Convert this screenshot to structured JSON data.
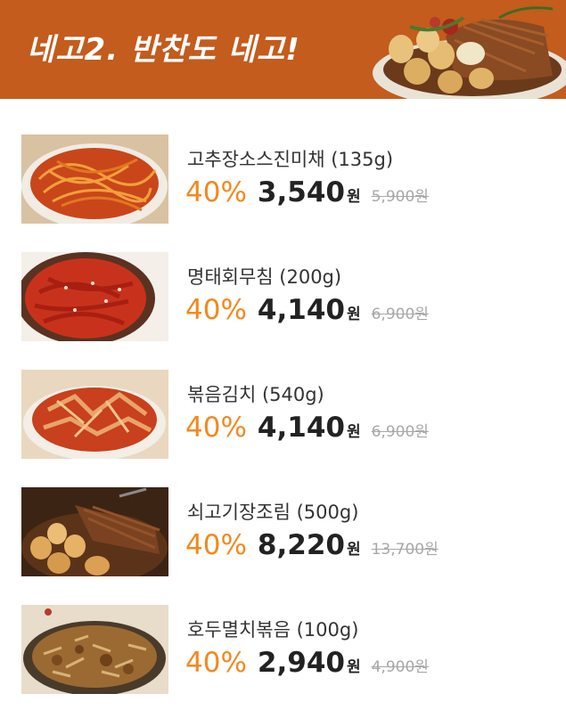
{
  "banner": {
    "title": "네고2. 반찬도 네고!",
    "photo_icon": "braised-beef-eggs-photo"
  },
  "colors": {
    "banner_bg": "#c35c1d",
    "discount": "#f2891e",
    "price": "#222222",
    "original_price": "#a8a8a8"
  },
  "products": [
    {
      "name": "고추장소스진미채 (135g)",
      "discount": "40%",
      "sale_price": "3,540",
      "sale_unit": "원",
      "original_price": "5,900원",
      "image_icon": "spicy-dried-squid-photo"
    },
    {
      "name": "명태회무침 (200g)",
      "discount": "40%",
      "sale_price": "4,140",
      "sale_unit": "원",
      "original_price": "6,900원",
      "image_icon": "seasoned-pollock-photo"
    },
    {
      "name": "볶음김치 (540g)",
      "discount": "40%",
      "sale_price": "4,140",
      "sale_unit": "원",
      "original_price": "6,900원",
      "image_icon": "stir-fried-kimchi-photo"
    },
    {
      "name": "쇠고기장조림 (500g)",
      "discount": "40%",
      "sale_price": "8,220",
      "sale_unit": "원",
      "original_price": "13,700원",
      "image_icon": "beef-jangjorim-photo"
    },
    {
      "name": "호두멸치볶음 (100g)",
      "discount": "40%",
      "sale_price": "2,940",
      "sale_unit": "원",
      "original_price": "4,900원",
      "image_icon": "walnut-anchovy-photo"
    }
  ]
}
